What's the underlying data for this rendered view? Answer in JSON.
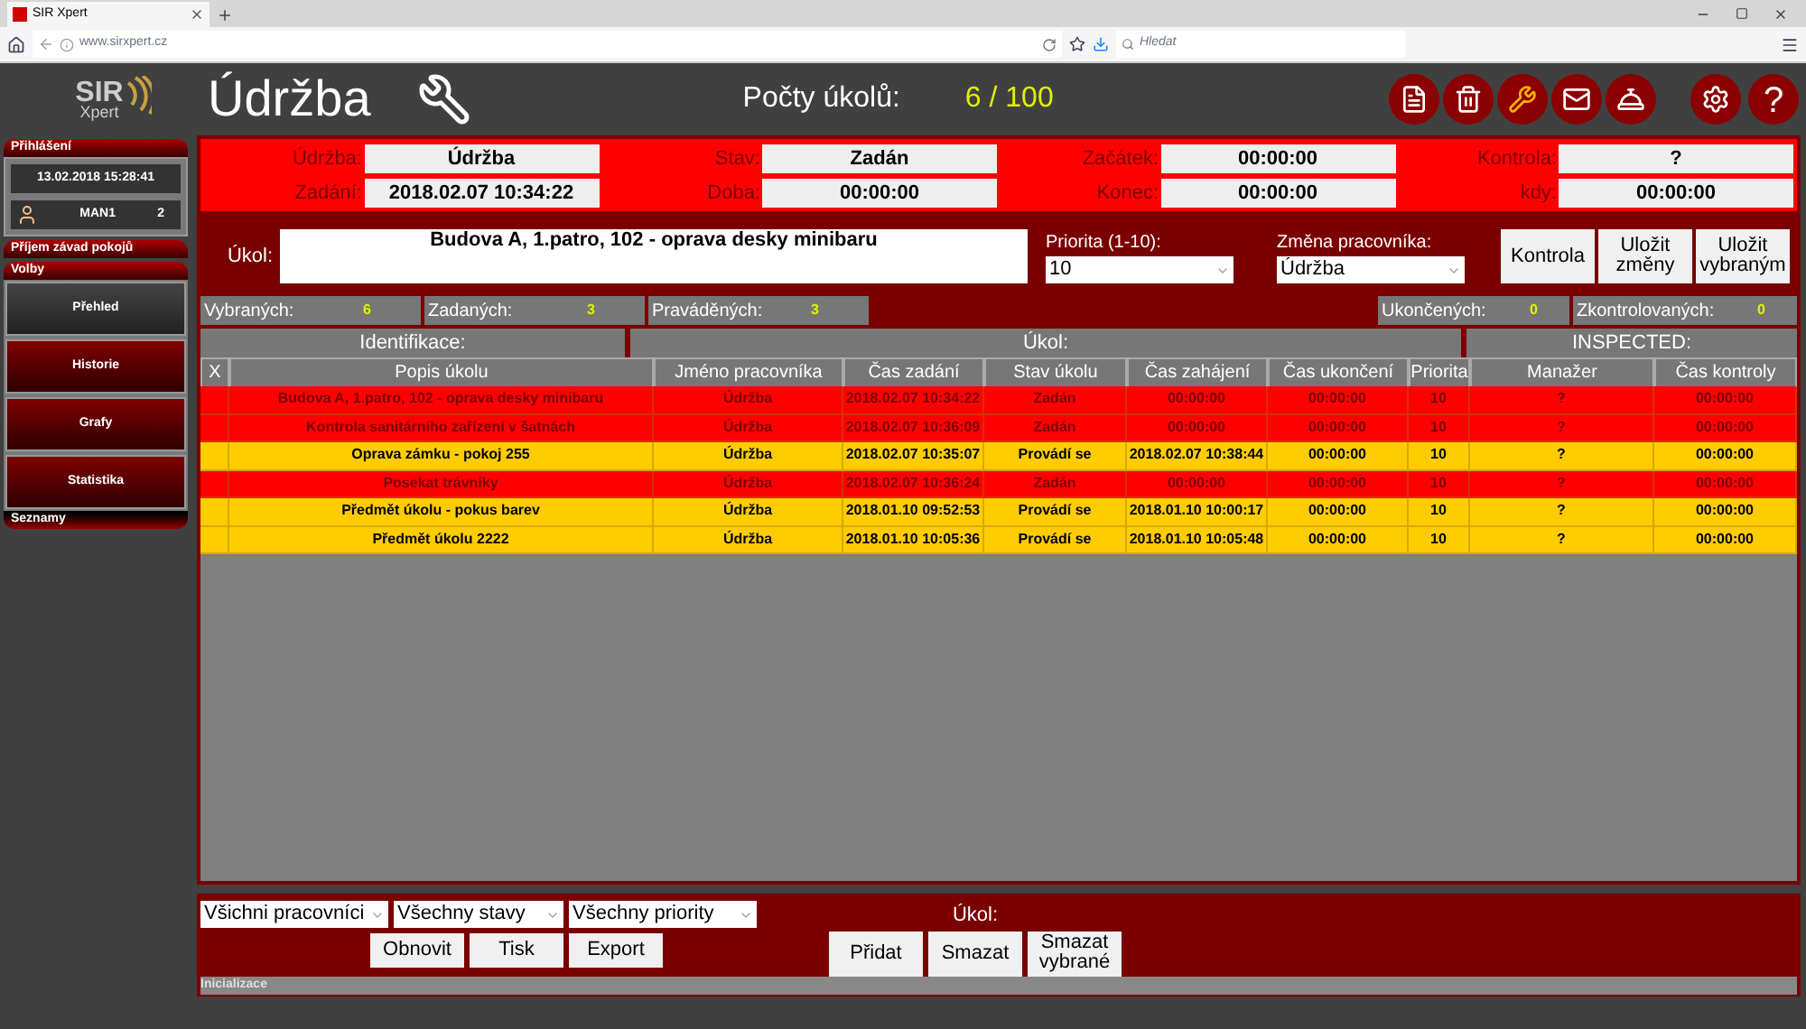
{
  "browser": {
    "tab_title": "SIR Xpert",
    "url": "www.sirxpert.cz",
    "search_placeholder": "Hledat"
  },
  "header": {
    "logo": "SIR",
    "logo_sub": "Xpert",
    "title": "Údržba",
    "counts_label": "Počty úkolů:",
    "counts_value": "6 / 100",
    "nav": [
      {
        "kind": "document",
        "selected": false
      },
      {
        "kind": "bin",
        "selected": false
      },
      {
        "kind": "wrench",
        "selected": true
      },
      {
        "kind": "mail",
        "selected": false
      },
      {
        "kind": "bell",
        "selected": false
      }
    ],
    "settings": {
      "kind": "settings"
    },
    "help": "?"
  },
  "sidebar": {
    "login_header": "Přihlášení",
    "datetime": "13.02.2018 15:28:41",
    "user": "MAN1",
    "user_count": "2",
    "faults_header": "Příjem závad pokojů",
    "options_header": "Volby",
    "items": [
      {
        "label": "Přehled",
        "selected": true
      },
      {
        "label": "Historie",
        "selected": false
      },
      {
        "label": "Grafy",
        "selected": false
      },
      {
        "label": "Statistika",
        "selected": false
      }
    ],
    "lists_header": "Seznamy"
  },
  "info": [
    {
      "label": "Údržba:",
      "value": "Údržba"
    },
    {
      "label": "Stav:",
      "value": "Zadán"
    },
    {
      "label": "Začátek:",
      "value": "00:00:00"
    },
    {
      "label": "Kontrola:",
      "value": "?"
    },
    {
      "label": "Zadání:",
      "value": "2018.02.07 10:34:22"
    },
    {
      "label": "Doba:",
      "value": "00:00:00"
    },
    {
      "label": "Konec:",
      "value": "00:00:00"
    },
    {
      "label": "kdy:",
      "value": "00:00:00"
    }
  ],
  "task": {
    "label": "Úkol:",
    "value": "Budova A, 1.patro, 102 - oprava desky minibaru",
    "priority_label": "Priorita (1-10):",
    "priority": "10",
    "worker_label": "Změna pracovníka:",
    "worker": "Údržba",
    "buttons": [
      "Kontrola",
      "Uložit změny",
      "Uložit vybraným"
    ]
  },
  "counts_left": [
    {
      "label": "Vybraných:",
      "value": "6"
    },
    {
      "label": "Zadaných:",
      "value": "3"
    },
    {
      "label": "Praváděných:",
      "value": "3"
    }
  ],
  "counts_right": [
    {
      "label": "Ukončených:",
      "value": "0"
    },
    {
      "label": "Zkontrolovaných:",
      "value": "0"
    }
  ],
  "table": {
    "groups": [
      "Identifikace:",
      "Úkol:",
      "INSPECTED:"
    ],
    "columns": [
      "X",
      "Popis úkolu",
      "Jméno pracovníka",
      "Čas zadání",
      "Stav úkolu",
      "Čas zahájení",
      "Čas ukončení",
      "Priorita",
      "Manažer",
      "Čas kontroly"
    ],
    "rows": [
      {
        "color": "#ff0000",
        "cells": [
          "",
          "Budova A, 1.patro, 102 - oprava desky minibaru",
          "Údržba",
          "2018.02.07 10:34:22",
          "Zadán",
          "00:00:00",
          "00:00:00",
          "10",
          "?",
          "00:00:00"
        ]
      },
      {
        "color": "#ff0000",
        "cells": [
          "",
          "Kontrola sanitárního zařízení v šatnách",
          "Údržba",
          "2018.02.07 10:36:09",
          "Zadán",
          "00:00:00",
          "00:00:00",
          "10",
          "?",
          "00:00:00"
        ]
      },
      {
        "color": "#ffcc00",
        "cells": [
          "",
          "Oprava zámku - pokoj 255",
          "Údržba",
          "2018.02.07 10:35:07",
          "Provádí se",
          "2018.02.07 10:38:44",
          "00:00:00",
          "10",
          "?",
          "00:00:00"
        ]
      },
      {
        "color": "#ff0000",
        "cells": [
          "",
          "Posekat trávníky",
          "Údržba",
          "2018.02.07 10:36:24",
          "Zadán",
          "00:00:00",
          "00:00:00",
          "10",
          "?",
          "00:00:00"
        ]
      },
      {
        "color": "#ffcc00",
        "cells": [
          "",
          "Předmět úkolu - pokus barev",
          "Údržba",
          "2018.01.10 09:52:53",
          "Provádí se",
          "2018.01.10 10:00:17",
          "00:00:00",
          "10",
          "?",
          "00:00:00"
        ]
      },
      {
        "color": "#ffcc00",
        "cells": [
          "",
          "Předmět úkolu 2222",
          "Údržba",
          "2018.01.10 10:05:36",
          "Provádí se",
          "2018.01.10 10:05:48",
          "00:00:00",
          "10",
          "?",
          "00:00:00"
        ]
      }
    ]
  },
  "footer": {
    "filters": [
      "Všichni pracovníci",
      "Všechny stavy",
      "Všechny priority"
    ],
    "buttons": [
      "Obnovit",
      "Tisk",
      "Export"
    ],
    "task_label": "Úkol:",
    "task_buttons": [
      "Přidat",
      "Smazat",
      "Smazat vybrané"
    ],
    "status": "Inicializace"
  }
}
